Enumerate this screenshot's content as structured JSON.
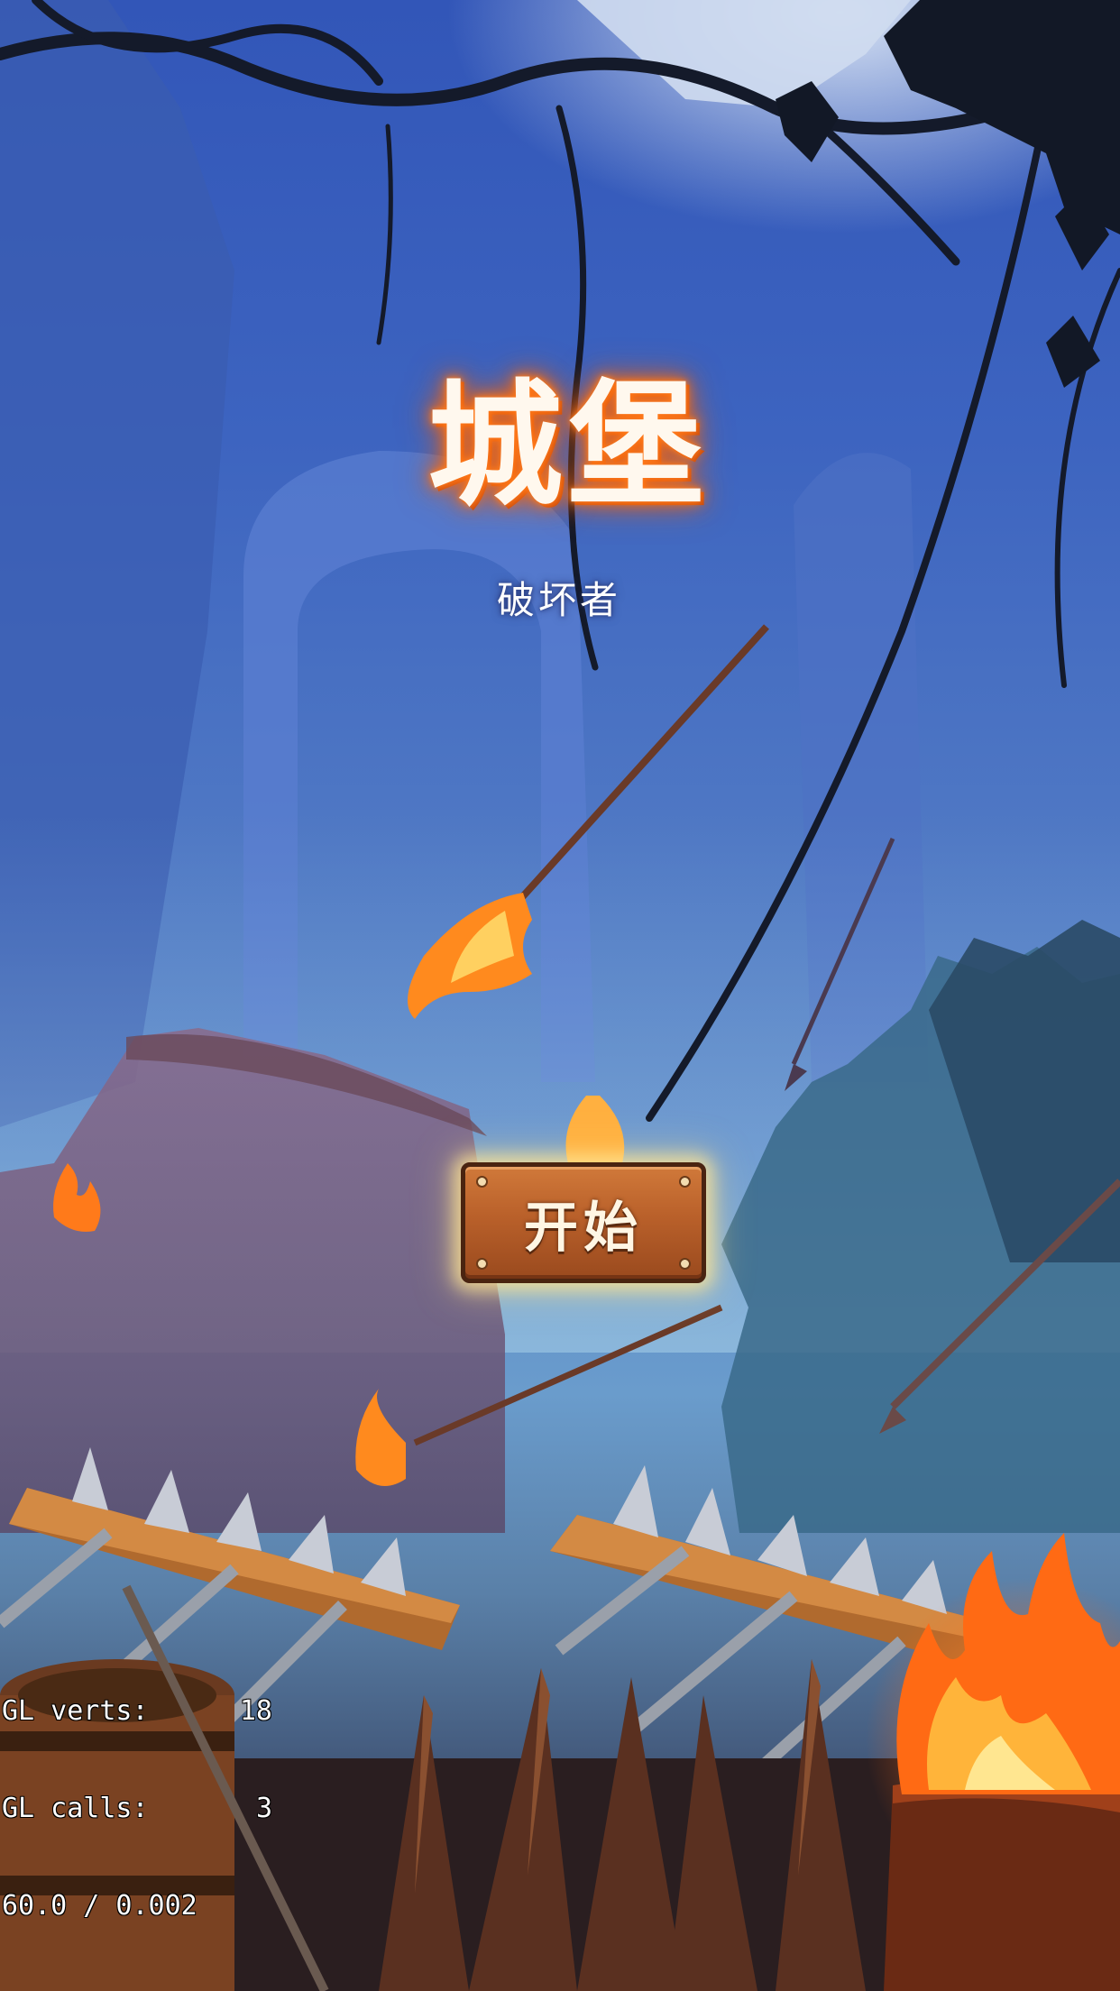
{
  "game": {
    "title_main": "城堡",
    "title_sub": "破坏者"
  },
  "menu": {
    "start_label": "开始"
  },
  "debug_stats": {
    "verts_label": "GL verts:",
    "verts_value": "18",
    "calls_label": "GL calls:",
    "calls_value": "3",
    "fps_line": "60.0 / 0.002"
  },
  "colors": {
    "sky_top": "#3256b8",
    "title_glow": "#ff7a1a",
    "button_wood": "#b9602a",
    "fire": "#ff8a1e"
  }
}
